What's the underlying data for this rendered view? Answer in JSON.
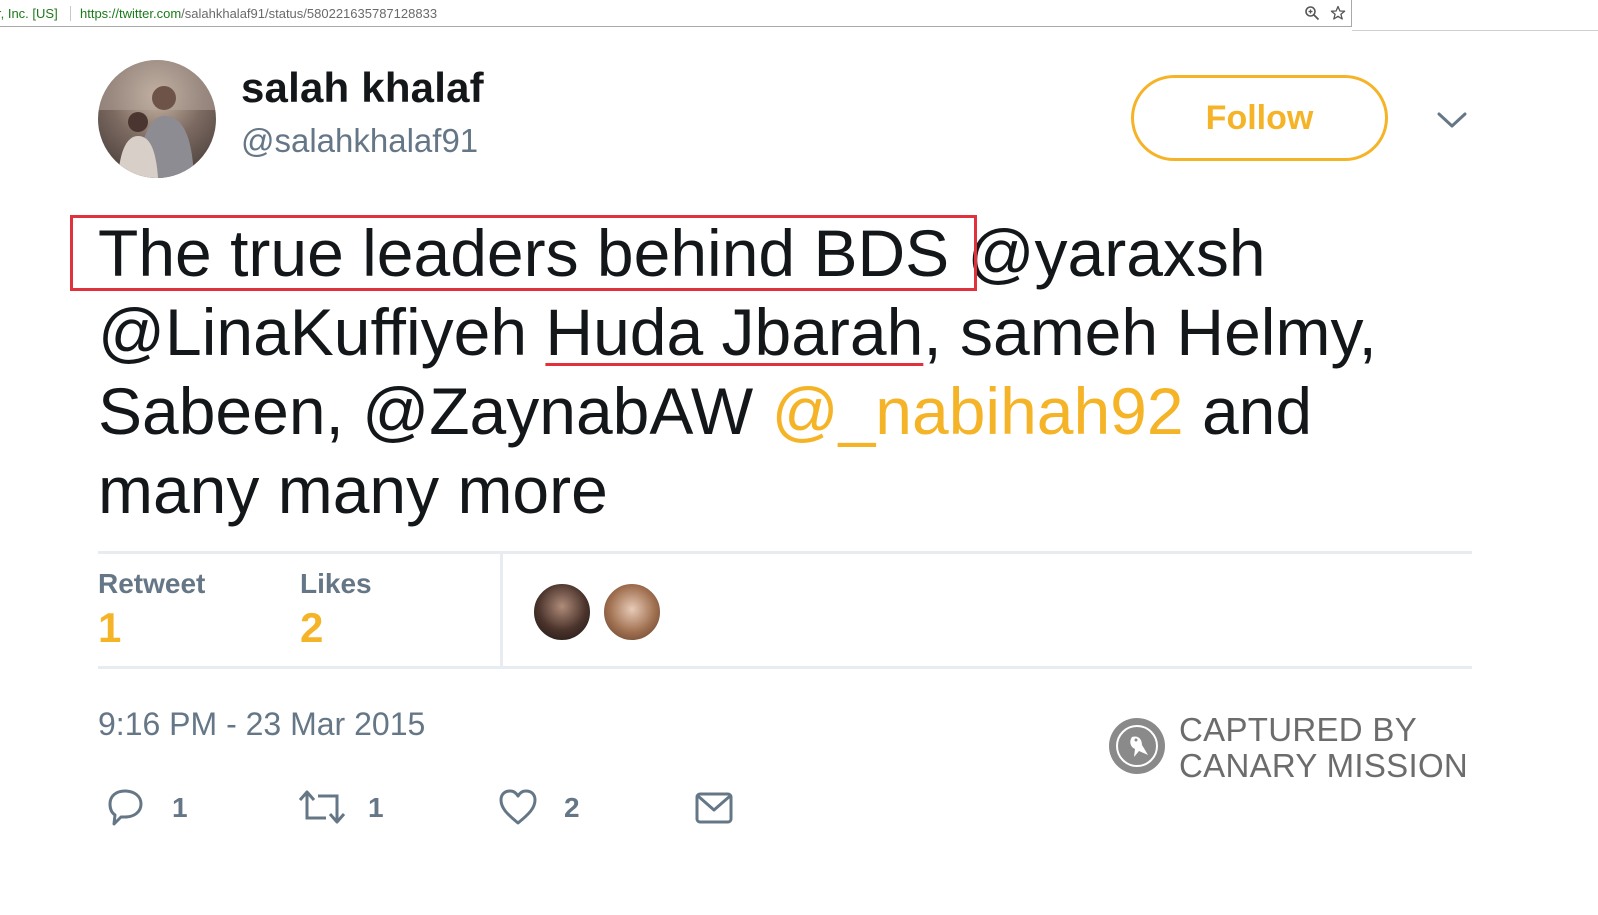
{
  "browser": {
    "secure_label": "r, Inc. [US]",
    "url_host": "https://twitter.com",
    "url_path": "/salahkhalaf91/status/580221635787128833"
  },
  "tweet": {
    "author_name": "salah khalaf",
    "author_handle": "@salahkhalaf91",
    "follow_label": "Follow",
    "text": {
      "boxed": "The true leaders behind BDS",
      "part1": " @yaraxsh @LinaKuffiyeh ",
      "underlined": "Huda Jbarah",
      "part2": ", sameh Helmy, Sabeen, @ZaynabAW ",
      "highlighted_mention": "@_nabihah92",
      "part3": " and many many more"
    },
    "stats": {
      "retweet_label": "Retweet",
      "retweet_count": "1",
      "likes_label": "Likes",
      "likes_count": "2"
    },
    "timestamp": "9:16 PM - 23 Mar 2015",
    "actions": {
      "reply_count": "1",
      "retweet_count": "1",
      "like_count": "2"
    }
  },
  "watermark": {
    "text": "CAPTURED BY\nCANARY MISSION"
  },
  "colors": {
    "accent": "#f5b428",
    "highlight_red": "#e0313d",
    "muted": "#657786"
  }
}
